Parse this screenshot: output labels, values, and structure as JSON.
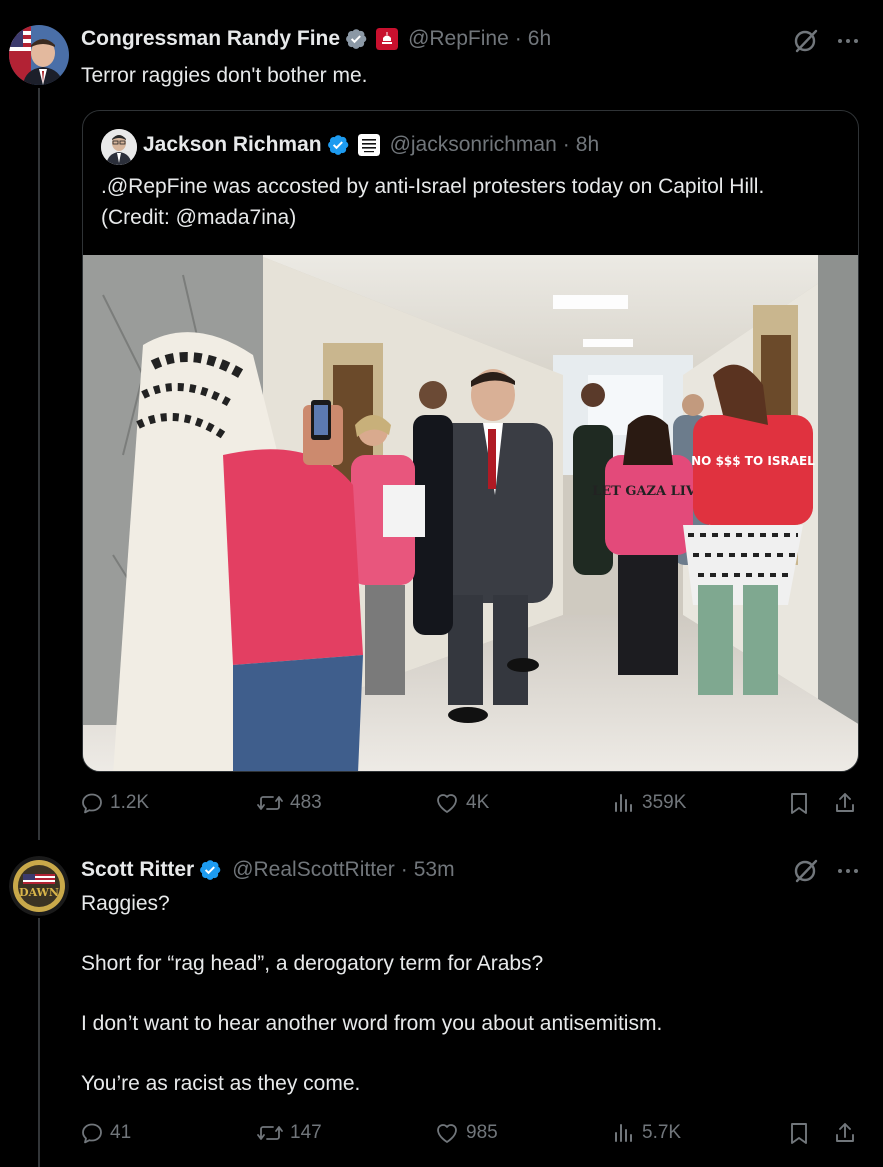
{
  "post1": {
    "author": {
      "name": "Congressman Randy Fine",
      "handle": "@RepFine",
      "time": "6h"
    },
    "text": "Terror raggies don't bother me.",
    "quote": {
      "author": {
        "name": "Jackson Richman",
        "handle": "@jacksonrichman",
        "time": "8h"
      },
      "text": ".@RepFine was accosted by anti-Israel protesters today on Capitol Hill.\n(Credit: @mada7ina)",
      "image_shirt_texts": {
        "shirt1": "LET GAZA LIVE",
        "shirt2": "NO $$$ TO ISRAEL"
      }
    },
    "stats": {
      "replies": "1.2K",
      "reposts": "483",
      "likes": "4K",
      "views": "359K"
    }
  },
  "post2": {
    "author": {
      "name": "Scott Ritter",
      "handle": "@RealScottRitter",
      "time": "53m"
    },
    "paragraphs": [
      "Raggies?",
      "Short for “rag head”, a derogatory term for Arabs?",
      "I don’t want to hear another word from you about antisemitism.",
      "You’re as racist as they come."
    ],
    "stats": {
      "replies": "41",
      "reposts": "147",
      "likes": "985",
      "views": "5.7K"
    }
  },
  "colors": {
    "background": "#000000",
    "text": "#e7e9ea",
    "muted": "#71767b",
    "verified": "#1d9bf0",
    "border": "#2f3336"
  },
  "icons": [
    "verified-badge-icon",
    "grok-icon",
    "more-icon",
    "reply-icon",
    "repost-icon",
    "like-icon",
    "views-icon",
    "bookmark-icon",
    "share-icon"
  ]
}
